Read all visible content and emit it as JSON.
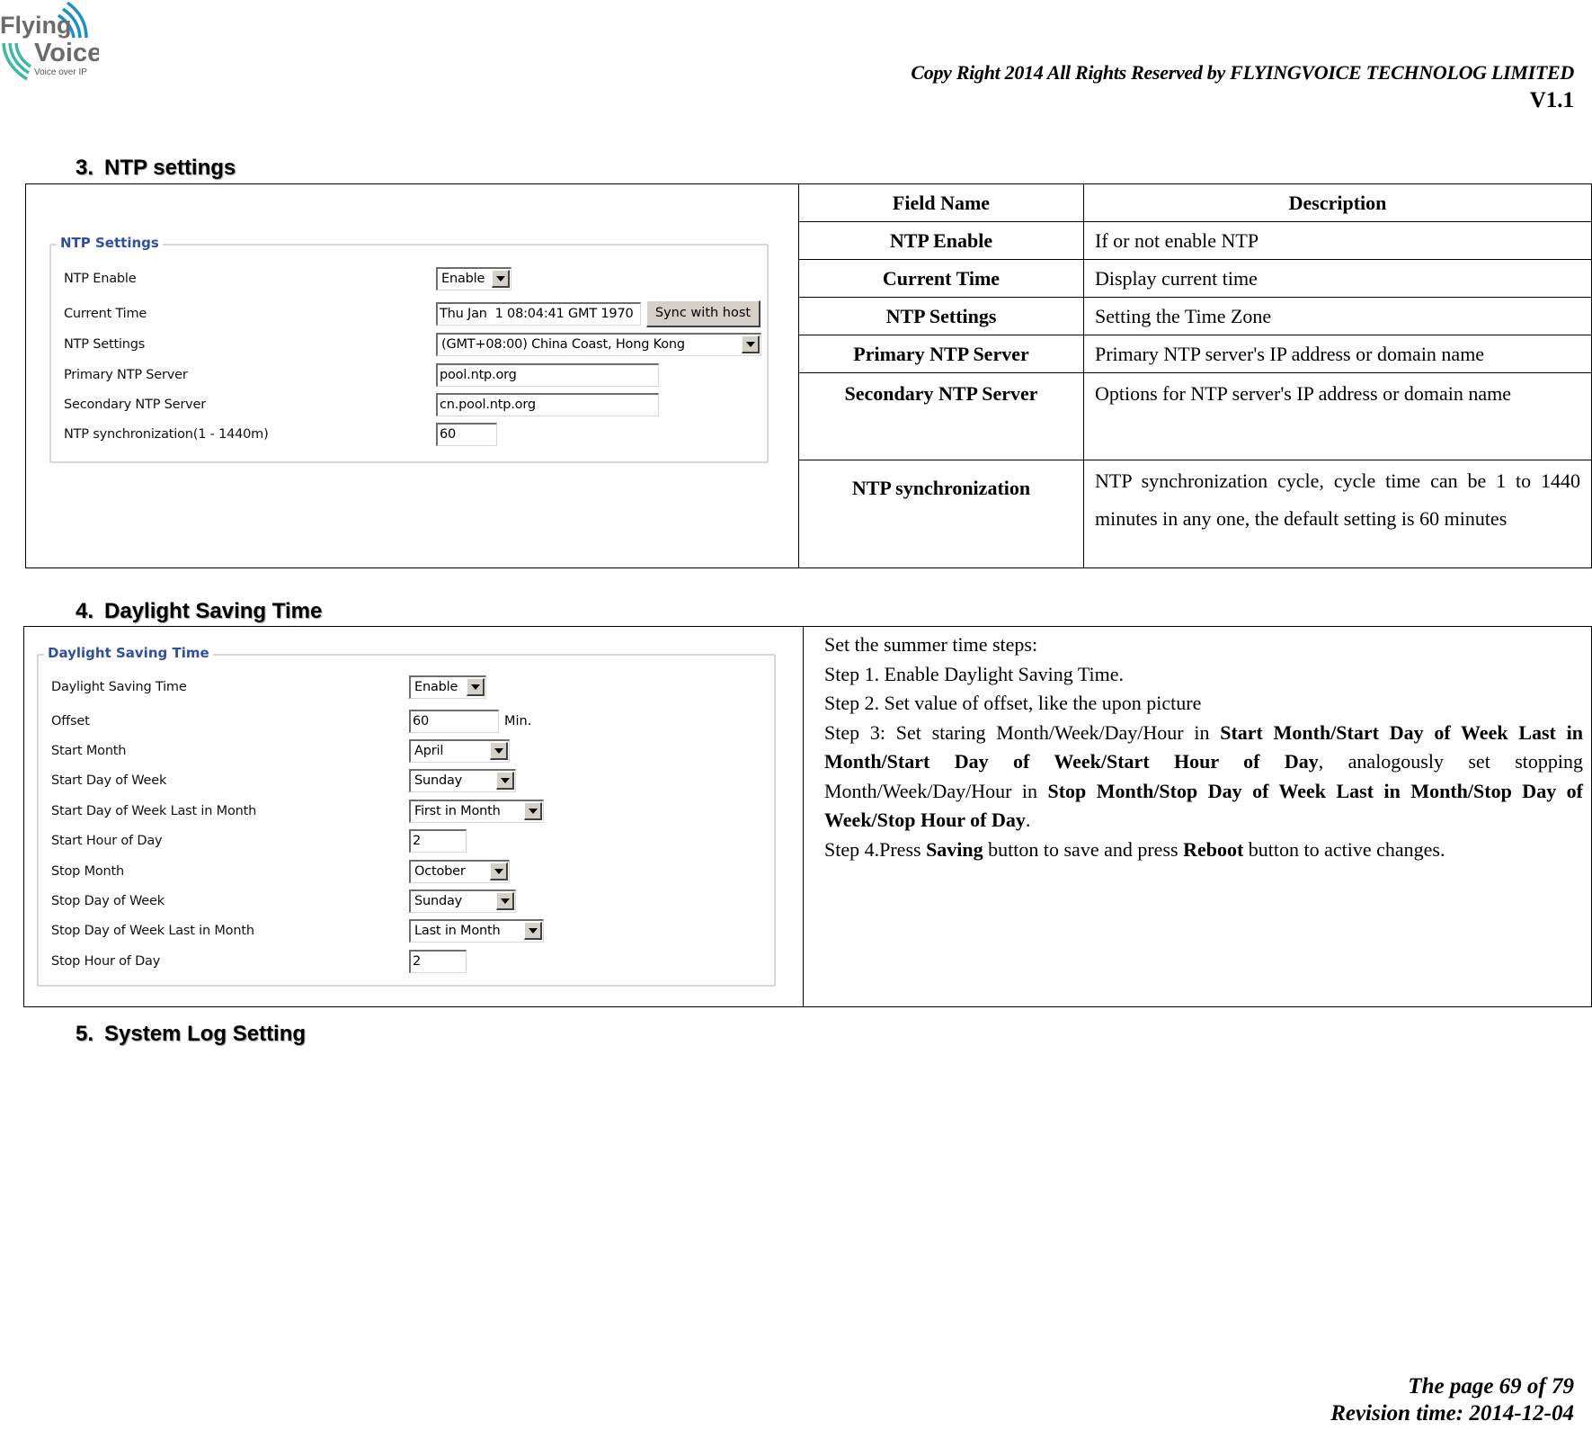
{
  "header": {
    "logo": {
      "line1": "Flying",
      "line2": "Voice",
      "tagline": "Voice over IP",
      "icon": "signal-waves-icon",
      "colors": {
        "text": "#6b6b6b",
        "wave_top": "#1e8fc7",
        "wave_bottom": "#3fb8a8"
      }
    },
    "copyright": "Copy Right 2014 All Rights Reserved by FLYINGVOICE TECHNOLOG LIMITED",
    "version": "V1.1"
  },
  "sections": {
    "ntp": {
      "number": "3.",
      "title": "NTP settings",
      "form": {
        "legend": "NTP Settings",
        "rows": [
          {
            "label": "NTP Enable",
            "type": "select",
            "value": "Enable"
          },
          {
            "label": "Current Time",
            "type": "input",
            "value": "Thu Jan  1 08:04:41 GMT 1970",
            "button": "Sync with host"
          },
          {
            "label": "NTP Settings",
            "type": "select",
            "value": "(GMT+08:00) China Coast, Hong Kong"
          },
          {
            "label": "Primary NTP Server",
            "type": "input",
            "value": "pool.ntp.org"
          },
          {
            "label": "Secondary NTP Server",
            "type": "input",
            "value": "cn.pool.ntp.org"
          },
          {
            "label": "NTP synchronization(1 - 1440m)",
            "type": "input",
            "value": "60"
          }
        ]
      },
      "table": {
        "headers": [
          "Field Name",
          "Description"
        ],
        "rows": [
          {
            "field": "NTP Enable",
            "description": "If or not enable NTP"
          },
          {
            "field": "Current Time",
            "description": "Display current time"
          },
          {
            "field": "NTP Settings",
            "description": "Setting the Time Zone"
          },
          {
            "field": "Primary NTP Server",
            "description": "Primary NTP server's IP address or domain name"
          },
          {
            "field": "Secondary NTP Server",
            "description": "Options for NTP server's IP address or domain name"
          },
          {
            "field": "NTP synchronization",
            "description": "NTP synchronization cycle, cycle time can be 1 to 1440 minutes in any one, the default setting is 60 minutes"
          }
        ]
      }
    },
    "dst": {
      "number": "4.",
      "title": "Daylight Saving Time",
      "form": {
        "legend": "Daylight Saving Time",
        "rows": [
          {
            "label": "Daylight Saving Time",
            "type": "select",
            "value": "Enable"
          },
          {
            "label": "Offset",
            "type": "input",
            "value": "60",
            "unit": "Min."
          },
          {
            "label": "Start Month",
            "type": "select",
            "value": "April"
          },
          {
            "label": "Start Day of Week",
            "type": "select",
            "value": "Sunday"
          },
          {
            "label": "Start Day of Week Last in Month",
            "type": "select",
            "value": "First in Month"
          },
          {
            "label": "Start Hour of Day",
            "type": "input",
            "value": "2"
          },
          {
            "label": "Stop Month",
            "type": "select",
            "value": "October"
          },
          {
            "label": "Stop Day of Week",
            "type": "select",
            "value": "Sunday"
          },
          {
            "label": "Stop Day of Week Last in Month",
            "type": "select",
            "value": "Last in Month"
          },
          {
            "label": "Stop Hour of Day",
            "type": "input",
            "value": "2"
          }
        ]
      },
      "steps": {
        "intro": "Set the summer time steps:",
        "step1": "Step 1. Enable Daylight Saving Time.",
        "step2": "Step 2. Set value of offset, like the upon picture",
        "step3_a": "Step 3: Set staring Month/Week/Day/Hour in ",
        "step3_b": "Start Month/Start Day of Week Last in Month/Start Day of Week/Start Hour of Day",
        "step3_c": ", analogously set stopping Month/Week/Day/Hour in ",
        "step3_d": "Stop Month/Stop Day of Week Last in Month/Stop Day of Week/Stop Hour of Day",
        "step3_e": ".",
        "step4_a": "Step 4.Press ",
        "step4_b": "Saving",
        "step4_c": " button to save and press ",
        "step4_d": "Reboot",
        "step4_e": " button to active changes."
      }
    },
    "syslog": {
      "number": "5.",
      "title": "System Log Setting"
    }
  },
  "footer": {
    "page": "The page 69 of 79",
    "revision": "Revision time: 2014-12-04"
  }
}
